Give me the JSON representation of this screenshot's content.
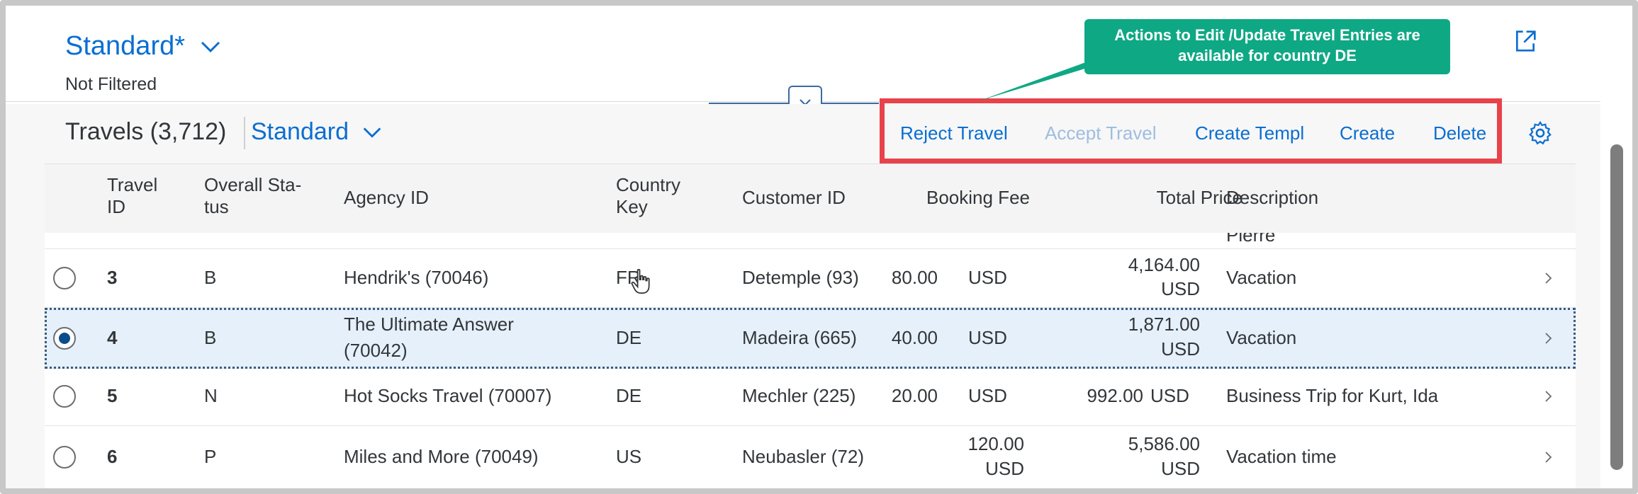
{
  "header": {
    "variant_label": "Standard*",
    "filter_status": "Not Filtered"
  },
  "table": {
    "title": "Travels (3,712)",
    "variant_label": "Standard",
    "actions": {
      "reject": "Reject Travel",
      "accept": "Accept Travel",
      "create_template": "Create Templ",
      "create": "Create",
      "delete": "Delete"
    },
    "columns": {
      "travel_id": [
        "Travel",
        "ID"
      ],
      "overall_status": [
        "Overall Sta-",
        "tus"
      ],
      "agency_id": "Agency ID",
      "country_key": [
        "Country",
        "Key"
      ],
      "customer_id": "Customer ID",
      "booking_fee": "Booking Fee",
      "total_price": "Total Price",
      "description": "Description"
    },
    "partial_text": "Pierre",
    "rows": [
      {
        "travel_id": "3",
        "status": "B",
        "agency": "Hendrik's (70046)",
        "country": "FR",
        "customer": "Detemple (93)",
        "fee": "80.00",
        "fee_cur": "USD",
        "price": "4,164.00",
        "price_cur": "USD",
        "description": "Vacation",
        "selected": false
      },
      {
        "travel_id": "4",
        "status": "B",
        "agency_l1": "The Ultimate Answer",
        "agency_l2": "(70042)",
        "country": "DE",
        "customer": "Madeira (665)",
        "fee": "40.00",
        "fee_cur": "USD",
        "price": "1,871.00",
        "price_cur": "USD",
        "description": "Vacation",
        "selected": true
      },
      {
        "travel_id": "5",
        "status": "N",
        "agency": "Hot Socks Travel (70007)",
        "country": "DE",
        "customer": "Mechler (225)",
        "fee": "20.00",
        "fee_cur": "USD",
        "price": "992.00",
        "price_cur": "USD",
        "description": "Business Trip for Kurt, Ida",
        "selected": false
      },
      {
        "travel_id": "6",
        "status": "P",
        "agency": "Miles and More (70049)",
        "country": "US",
        "customer": "Neubasler (72)",
        "fee": "120.00",
        "fee_cur": "USD",
        "price": "5,586.00",
        "price_cur": "USD",
        "description": "Vacation time",
        "selected": false
      }
    ]
  },
  "callout": {
    "line1": "Actions to Edit /Update Travel Entries are",
    "line2": "available for country DE",
    "color": "#0fa884"
  },
  "colors": {
    "accent": "#0a6ed1",
    "highlight": "#e8424a",
    "selected_row": "#e5f0fa"
  }
}
